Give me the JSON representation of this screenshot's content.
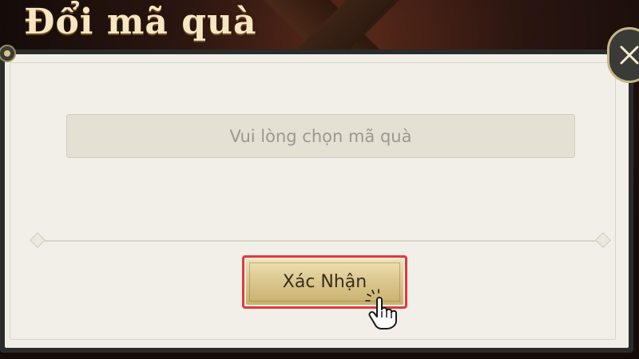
{
  "dialog": {
    "title": "Đổi mã quà",
    "code_input": {
      "placeholder": "Vui lòng chọn mã quà",
      "value": ""
    },
    "confirm_label": "Xác Nhận",
    "close_icon": "close-icon"
  },
  "colors": {
    "panel": "#f1efe8",
    "button_gold": "#d8c48a",
    "highlight_red": "#e23a3a",
    "title_text": "#f6e6c2"
  },
  "icons": [
    "close-icon",
    "hand-pointer-icon",
    "ornament-knob-icon",
    "diamond-ornament-icon"
  ]
}
